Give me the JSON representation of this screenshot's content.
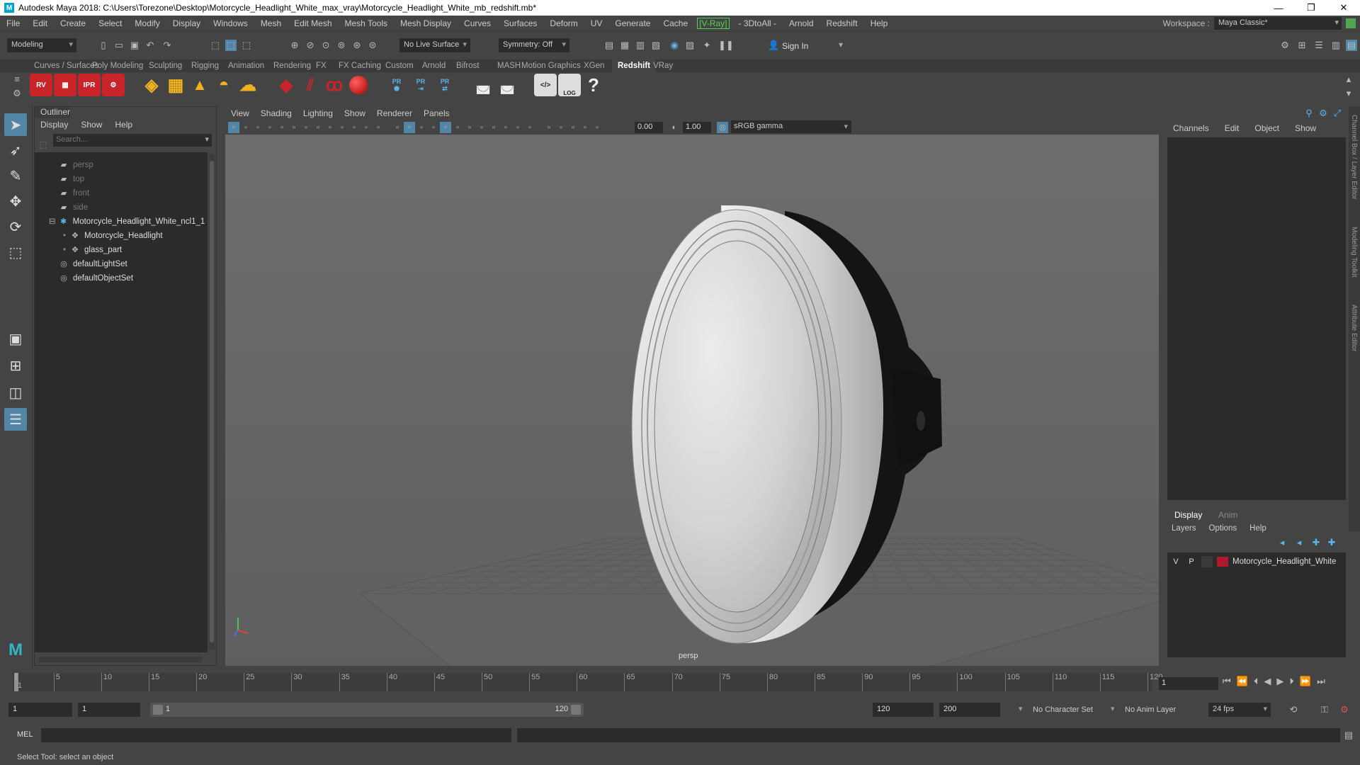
{
  "window": {
    "title": "Autodesk Maya 2018: C:\\Users\\Torezone\\Desktop\\Motorcycle_Headlight_White_max_vray\\Motorcycle_Headlight_White_mb_redshift.mb*",
    "minimize": "—",
    "restore": "❐",
    "close": "✕"
  },
  "menubar": {
    "items": [
      "File",
      "Edit",
      "Create",
      "Select",
      "Modify",
      "Display",
      "Windows",
      "Mesh",
      "Edit Mesh",
      "Mesh Tools",
      "Mesh Display",
      "Curves",
      "Surfaces",
      "Deform",
      "UV",
      "Generate",
      "Cache",
      "[V-Ray]",
      "- 3DtoAll -",
      "Arnold",
      "Redshift",
      "Help"
    ],
    "workspace_label": "Workspace :",
    "workspace_value": "Maya Classic*"
  },
  "statusline": {
    "mode": "Modeling",
    "live_surface": "No Live Surface",
    "symmetry": "Symmetry: Off",
    "sign_in": "Sign In"
  },
  "shelf": {
    "tabs": [
      "Curves / Surfaces",
      "Poly Modeling",
      "Sculpting",
      "Rigging",
      "Animation",
      "Rendering",
      "FX",
      "FX Caching",
      "Custom",
      "Arnold",
      "Bifrost",
      "MASH",
      "Motion Graphics",
      "XGen",
      "Redshift",
      "VRay"
    ],
    "active_tab": "Redshift",
    "icon_labels": {
      "rv": "RV",
      "ipr": "IPR",
      "pr": "PR",
      "log": "LOG"
    }
  },
  "outliner": {
    "title": "Outliner",
    "menu": [
      "Display",
      "Show",
      "Help"
    ],
    "search_placeholder": "Search...",
    "items": [
      {
        "label": "persp",
        "icon": "camera-icon",
        "dim": true
      },
      {
        "label": "top",
        "icon": "camera-icon",
        "dim": true
      },
      {
        "label": "front",
        "icon": "camera-icon",
        "dim": true
      },
      {
        "label": "side",
        "icon": "camera-icon",
        "dim": true
      },
      {
        "label": "Motorcycle_Headlight_White_ncl1_1",
        "icon": "group-icon",
        "dim": false
      },
      {
        "label": "Motorcycle_Headlight",
        "icon": "mesh-icon",
        "dim": false
      },
      {
        "label": "glass_part",
        "icon": "mesh-icon",
        "dim": false
      },
      {
        "label": "defaultLightSet",
        "icon": "set-icon",
        "dim": false
      },
      {
        "label": "defaultObjectSet",
        "icon": "set-icon",
        "dim": false
      }
    ]
  },
  "viewport": {
    "menu": [
      "View",
      "Shading",
      "Lighting",
      "Show",
      "Renderer",
      "Panels"
    ],
    "exposure": "0.00",
    "gamma": "1.00",
    "color_space": "sRGB gamma",
    "camera_label": "persp"
  },
  "channelbox": {
    "menu": [
      "Channels",
      "Edit",
      "Object",
      "Show"
    ]
  },
  "layereditor": {
    "tabs": [
      "Display",
      "Anim"
    ],
    "menu": [
      "Layers",
      "Options",
      "Help"
    ],
    "layer": {
      "v": "V",
      "p": "P",
      "name": "Motorcycle_Headlight_White",
      "color": "#b0192c"
    }
  },
  "sidetabs": [
    "Channel Box / Layer Editor",
    "Modeling Toolkit",
    "Attribute Editor"
  ],
  "timeline": {
    "tick_labels": [
      "1",
      "5",
      "10",
      "15",
      "20",
      "25",
      "30",
      "35",
      "40",
      "45",
      "50",
      "55",
      "60",
      "65",
      "70",
      "75",
      "80",
      "85",
      "90",
      "95",
      "100",
      "105",
      "110",
      "115",
      "120"
    ],
    "current_frame": "1"
  },
  "range": {
    "start": "1",
    "inner_start": "1",
    "slider_start": "1",
    "slider_end": "120",
    "end": "120",
    "outer_end": "200",
    "character_set": "No Character Set",
    "anim_layer": "No Anim Layer",
    "fps": "24 fps"
  },
  "commandline": {
    "label": "MEL"
  },
  "helpline": {
    "text": "Select Tool: select an object"
  }
}
